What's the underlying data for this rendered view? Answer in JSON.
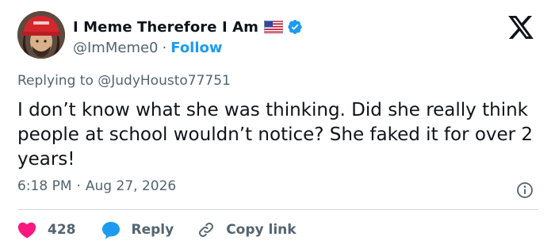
{
  "author": {
    "display_name": "I Meme Therefore I Am",
    "handle": "@ImMeme0",
    "separator": "·",
    "follow_label": "Follow",
    "flag_icon": "us-flag-icon",
    "verified_icon": "verified-badge-icon",
    "verified_color": "#1d9bf0"
  },
  "platform_icon": "x-logo-icon",
  "tweet": {
    "replying_to": "Replying to @JudyHousto77751",
    "text": "I don’t know what she was thinking. Did she really think people at school wouldn’t notice? She faked it for over 2 years!",
    "time": "6:18 PM",
    "separator": "·",
    "date": "Aug 27, 2026"
  },
  "actions": {
    "like_count": "428",
    "like_color": "#f91880",
    "reply_label": "Reply",
    "reply_color": "#1d9bf0",
    "copy_label": "Copy link"
  },
  "colors": {
    "text_primary": "#0f1419",
    "text_secondary": "#536471",
    "accent": "#1d9bf0"
  }
}
